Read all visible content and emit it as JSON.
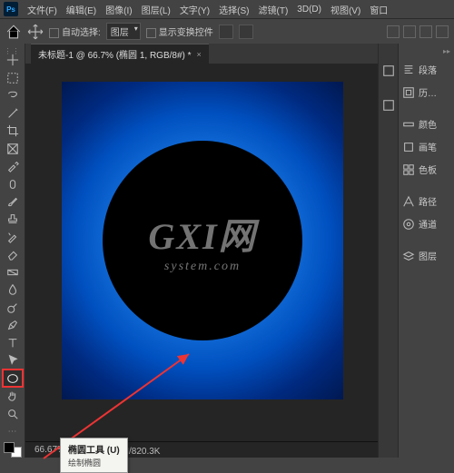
{
  "menu": {
    "items": [
      "文件(F)",
      "编辑(E)",
      "图像(I)",
      "图层(L)",
      "文字(Y)",
      "选择(S)",
      "滤镜(T)",
      "3D(D)",
      "视图(V)",
      "窗口"
    ]
  },
  "options": {
    "auto_select": "自动选择:",
    "layer_label": "图层",
    "show_transform": "显示变换控件"
  },
  "document": {
    "tab_title": "未标题-1 @ 66.7% (椭圆 1, RGB/8#) *"
  },
  "tooltip": {
    "title": "椭圆工具 (U)",
    "desc": "绘制椭圆"
  },
  "status": {
    "zoom": "66.67%",
    "docinfo": "文档:1.20M/820.3K"
  },
  "right_panel": {
    "items": [
      "段落",
      "历…",
      "颜色",
      "画笔",
      "色板",
      "路径",
      "通道",
      "图层"
    ]
  },
  "watermark": {
    "line1": "GXI网",
    "line2": "system.com"
  }
}
